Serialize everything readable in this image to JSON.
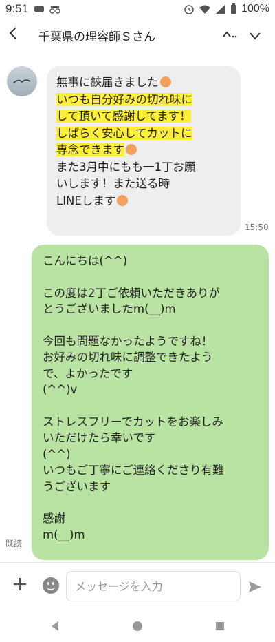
{
  "status_bar": {
    "time": "9:51",
    "battery": "100%"
  },
  "header": {
    "back_icon": "‹",
    "title": "千葉県の理容師Ｓさん",
    "menu_icon": "へ…",
    "chevron_icon": "∨"
  },
  "incoming_message": {
    "lines": [
      "無事に鋏届きました",
      "いつも自分好みの切れ味に",
      "して頂いて感謝してます！",
      "しばらく安心してカットに",
      "専念できます",
      "",
      "また3月中にもも一1丁お願",
      "いします！また送る時",
      "LINEします"
    ],
    "time": "15:50"
  },
  "outgoing_message": {
    "lines": [
      "こんにちは(^^)",
      "",
      "この度は2丁ご依頼いただきありが",
      "とうございましたm(__)m",
      "",
      "今回も問題なかったようですね！",
      "お好みの切れ味に調整できたよう",
      "で、よかったです",
      "(^^)v",
      "",
      "ストレスフリーでカットをお楽しみ",
      "いただけたら幸いです",
      "(^^)",
      "いつもご丁寧にご連絡くださり有難",
      "うございます",
      "",
      "感謝",
      "m(__)m"
    ],
    "read_label": "既読"
  },
  "input_bar": {
    "placeholder": "メッセージを入力",
    "plus_icon": "+"
  },
  "colors": {
    "outgoing_bubble": "#b9e3a2",
    "incoming_bubble": "#eeeeee",
    "highlight": "#ffef3a"
  }
}
